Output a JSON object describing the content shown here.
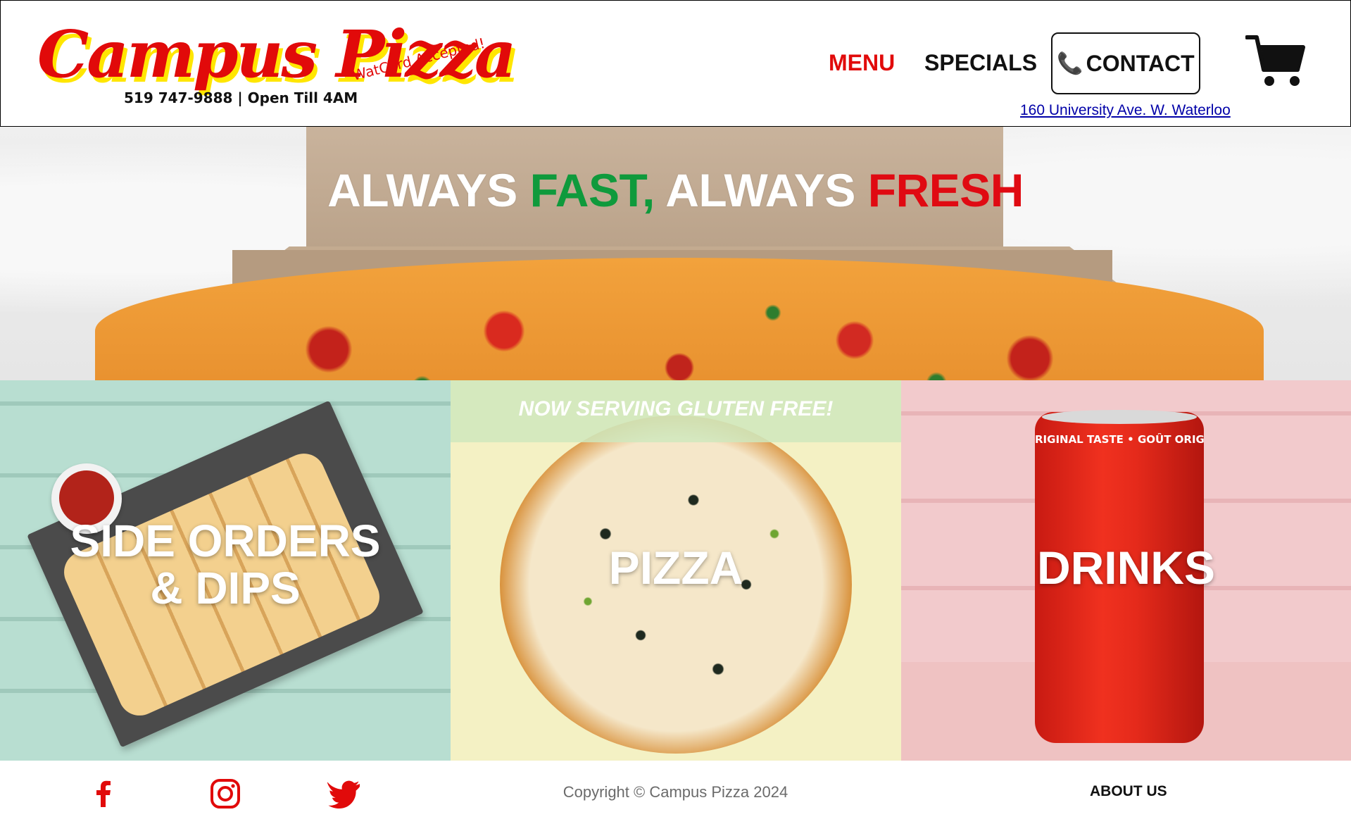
{
  "header": {
    "logo_text": "Campus Pizza",
    "phone_hours": "519 747-9888 | Open Till 4AM",
    "watcard_note": "WatCard Accepted!",
    "nav": {
      "menu_label": "MENU",
      "specials_label": "SPECIALS",
      "contact_label": "CONTACT"
    },
    "address_link": "160 University Ave. W. Waterloo"
  },
  "hero": {
    "tagline_part1": "ALWAYS ",
    "tagline_fast": "FAST,",
    "tagline_part2": " ALWAYS ",
    "tagline_fresh": "FRESH"
  },
  "categories": {
    "sides_line1": "SIDE ORDERS",
    "sides_line2": "& DIPS",
    "gluten_banner": "NOW SERVING GLUTEN FREE!",
    "pizza_label": "PIZZA",
    "can_text": "RIGINAL TASTE • GOÛT ORIGINAL",
    "drinks_label": "DRINKS"
  },
  "footer": {
    "copyright": "Copyright © Campus Pizza 2024",
    "about_label": "ABOUT US"
  },
  "colors": {
    "brand_red": "#e10a0a",
    "accent_yellow": "#ffe600",
    "fast_green": "#0f9a3c",
    "link_blue": "#0000a8"
  },
  "icons": {
    "phone": "phone-icon",
    "cart": "cart-icon",
    "facebook": "facebook-icon",
    "instagram": "instagram-icon",
    "twitter": "twitter-icon"
  }
}
